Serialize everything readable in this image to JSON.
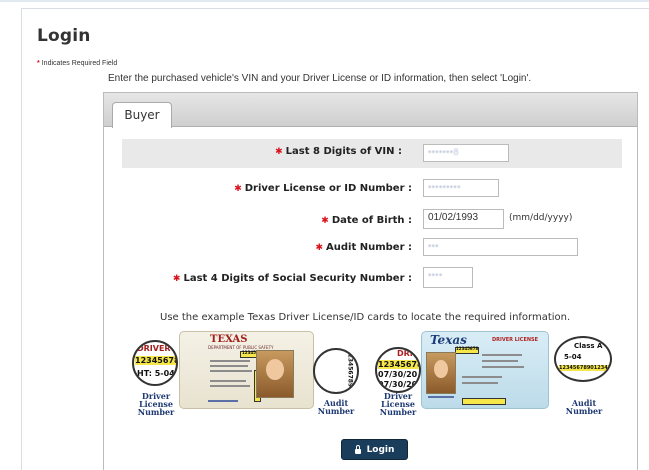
{
  "page": {
    "title": "Login",
    "required_note": "Indicates Required Field",
    "required_star": "*",
    "instructions": "Enter the purchased vehicle's VIN and your Driver License or ID information, then select 'Login'."
  },
  "tabs": [
    {
      "label": "Buyer",
      "active": true
    }
  ],
  "form": {
    "vin": {
      "label": "Last 8 Digits of VIN :",
      "value": "•••••••8"
    },
    "license": {
      "label": "Driver License or ID Number :",
      "value": "•••••••••"
    },
    "dob": {
      "label": "Date of Birth :",
      "value": "01/02/1993",
      "hint": "(mm/dd/yyyy)"
    },
    "audit": {
      "label": "Audit Number :",
      "value": "•••"
    },
    "ssn": {
      "label": "Last 4 Digits of Social Security Number :",
      "value": "••••"
    }
  },
  "example": {
    "text": "Use the example Texas Driver License/ID cards to locate the required information.",
    "old_card": {
      "state": "TEXAS",
      "header": "DEPARTMENT OF PUBLIC SAFETY",
      "dl_tag": "12345678"
    },
    "new_card": {
      "state": "Texas",
      "header": "DRIVER LICENSE",
      "dl_tag": "12345678"
    },
    "magnifiers": {
      "m1_lines": [
        "DRIVER",
        "12345678",
        "HT: 5-04"
      ],
      "m2_lines": [
        "12345678901"
      ],
      "m3_lines": [
        "DRI",
        "12345678",
        "07/30/20",
        "07/30/20"
      ],
      "m4_lines": [
        "Class A",
        "5-04",
        "123456789012345"
      ]
    },
    "captions": {
      "c1": [
        "Driver",
        "License",
        "Number"
      ],
      "c2": [
        "Audit",
        "Number"
      ],
      "c3": [
        "Driver",
        "License",
        "Number"
      ],
      "c4": [
        "Audit",
        "Number"
      ]
    }
  },
  "actions": {
    "login_label": "Login"
  },
  "colors": {
    "required": "#d9121b",
    "button": "#1b3d5c",
    "caption": "#1e3a73"
  }
}
